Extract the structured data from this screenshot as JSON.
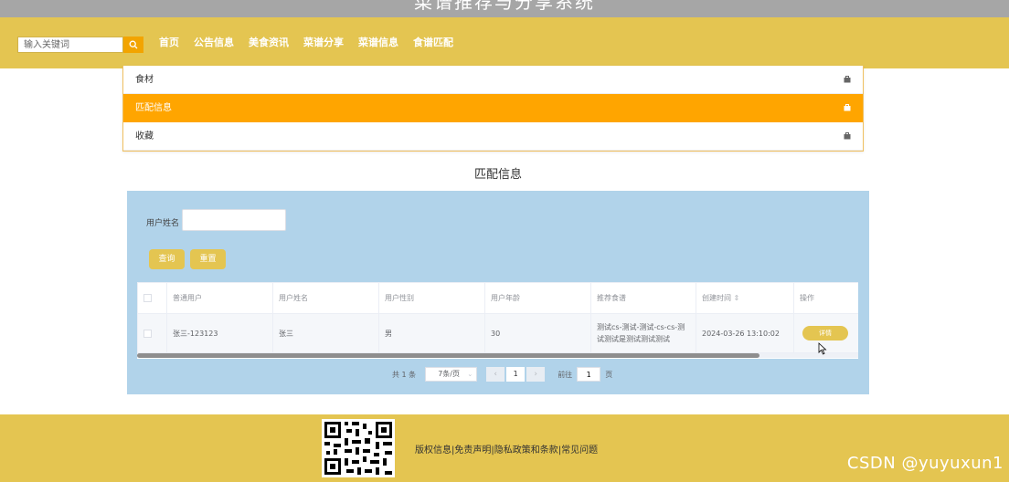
{
  "site": {
    "title": "菜谱推荐与分享系统"
  },
  "search": {
    "placeholder": "输入关键词"
  },
  "nav": {
    "items": [
      "首页",
      "公告信息",
      "美食资讯",
      "菜谱分享",
      "菜谱信息",
      "食谱匹配"
    ]
  },
  "side_menu": {
    "items": [
      {
        "label": "食材",
        "active": false
      },
      {
        "label": "匹配信息",
        "active": true
      },
      {
        "label": "收藏",
        "active": false
      }
    ]
  },
  "page": {
    "title": "匹配信息"
  },
  "filter": {
    "label": "用户姓名",
    "value": "",
    "query_label": "查询",
    "reset_label": "重置"
  },
  "table": {
    "columns": [
      "普通用户",
      "用户姓名",
      "用户性别",
      "用户年龄",
      "推荐食谱",
      "创建时间",
      "操作"
    ],
    "sort_mark": "⇕",
    "rows": [
      {
        "user": "张三-123123",
        "name": "张三",
        "gender": "男",
        "age": "30",
        "recipe": "测试cs-测试-测试-cs-cs-测试测试是测试测试测试",
        "created": "2024-03-26 13:10:02",
        "action": "详情"
      }
    ]
  },
  "pagination": {
    "total_text": "共 1 条",
    "page_size": "7条/页",
    "prev": "‹",
    "current": "1",
    "next": "›",
    "goto_label": "前往",
    "goto_value": "1",
    "page_suffix": "页"
  },
  "footer": {
    "links_text": "版权信息|免责声明|隐私政策和条款|常见问题"
  },
  "watermark": "CSDN @yuyuxun1",
  "colors": {
    "brand": "#e4c551",
    "accent": "#ffa500",
    "panel": "#b1d3ea"
  }
}
